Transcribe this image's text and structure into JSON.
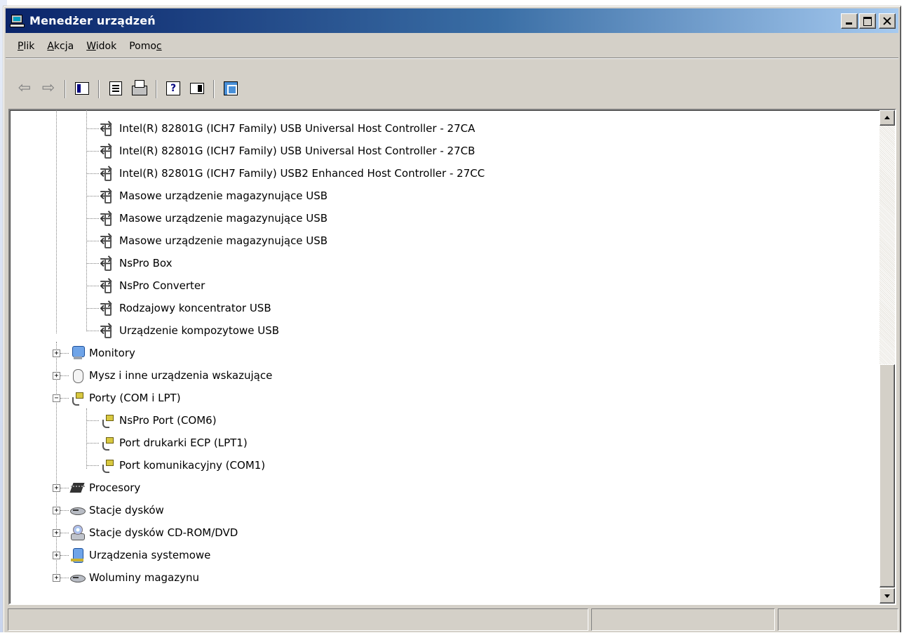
{
  "window": {
    "title": "Menedżer urządzeń",
    "icon": "device-manager-icon"
  },
  "menu": [
    {
      "name": "menu-plik",
      "mnemonic": "P",
      "rest": "lik"
    },
    {
      "name": "menu-akcja",
      "mnemonic": "A",
      "rest": "kcja"
    },
    {
      "name": "menu-widok",
      "mnemonic": "W",
      "rest": "idok"
    },
    {
      "name": "menu-pomoc",
      "label_pre": "Pomo",
      "mnemonic": "c"
    }
  ],
  "toolbar": {
    "back": "⇦",
    "forward": "⇨"
  },
  "tree": {
    "usb_items": [
      "Intel(R) 82801G (ICH7 Family) USB Universal Host Controller - 27CA",
      "Intel(R) 82801G (ICH7 Family) USB Universal Host Controller - 27CB",
      "Intel(R) 82801G (ICH7 Family) USB2 Enhanced Host Controller - 27CC",
      "Masowe urządzenie magazynujące USB",
      "Masowe urządzenie magazynujące USB",
      "Masowe urządzenie magazynujące USB",
      "NsPro Box",
      "NsPro Converter",
      "Rodzajowy koncentrator USB",
      "Urządzenie kompozytowe USB"
    ],
    "categories": {
      "monitory": "Monitory",
      "mysz": "Mysz i inne urządzenia wskazujące",
      "porty": "Porty (COM i LPT)",
      "procesory": "Procesory",
      "stacje_dyskow": "Stacje dysków",
      "cdrom": "Stacje dysków CD-ROM/DVD",
      "systemowe": "Urządzenia systemowe",
      "woluminy": "Woluminy magazynu"
    },
    "port_items": [
      "NsPro Port (COM6)",
      "Port drukarki ECP (LPT1)",
      "Port komunikacyjny (COM1)"
    ],
    "expand_plus": "+",
    "expand_minus": "−"
  },
  "statusbar": {
    "panel1": "",
    "panel2": "",
    "panel3": ""
  }
}
